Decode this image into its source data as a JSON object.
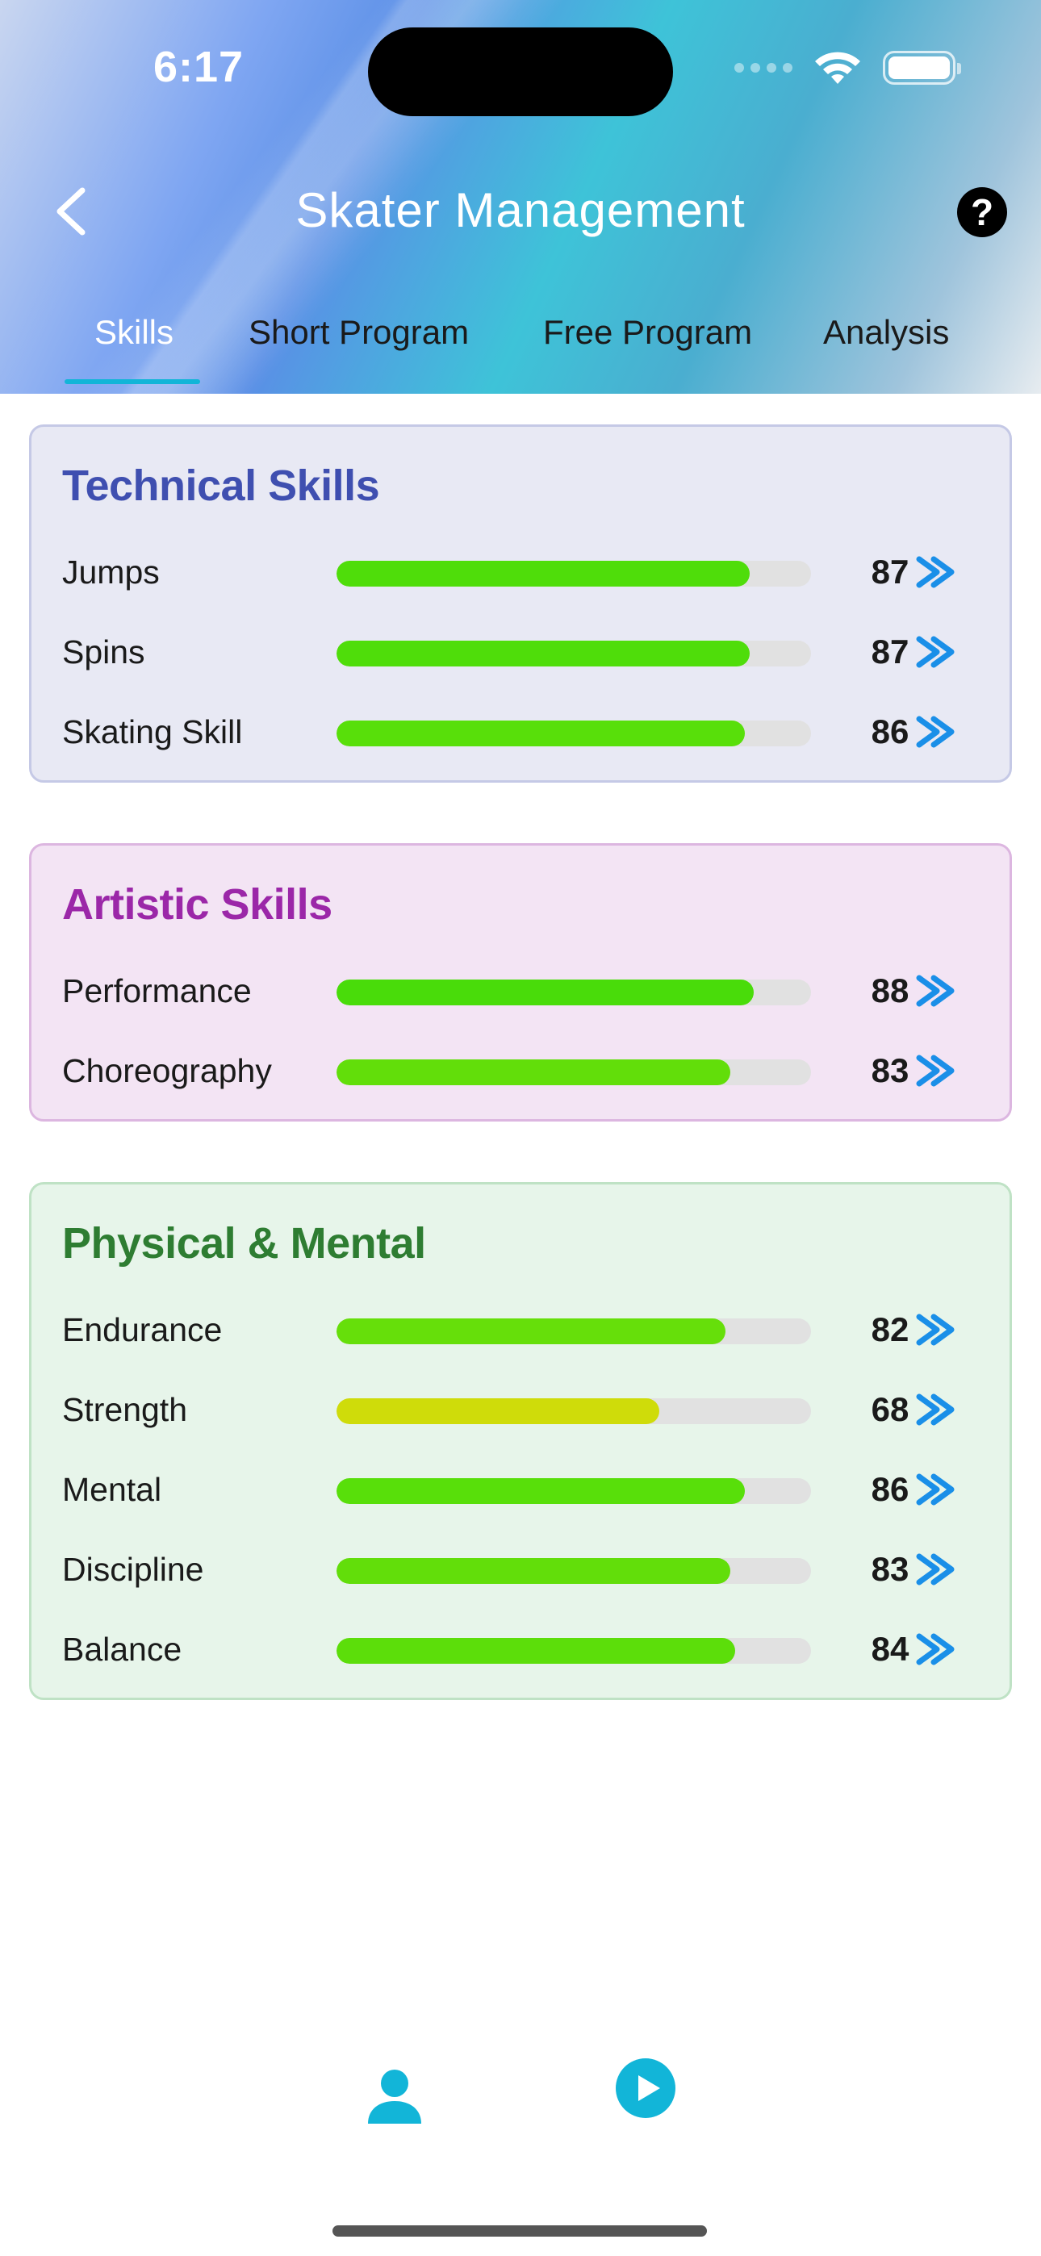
{
  "status_bar": {
    "time": "6:17"
  },
  "header": {
    "title": "Skater Management",
    "tabs": [
      "Skills",
      "Short Program",
      "Free Program",
      "Analysis"
    ],
    "active_tab": "Skills"
  },
  "sections": [
    {
      "title": "Technical Skills",
      "title_color": "#3f4fb0",
      "bg": "#e8e9f4",
      "border": "#c5c9e6",
      "items": [
        {
          "label": "Jumps",
          "value": "87",
          "level": 0.87,
          "color": "#4fdd0a"
        },
        {
          "label": "Spins",
          "value": "87",
          "level": 0.87,
          "color": "#4fdd0a"
        },
        {
          "label": "Skating Skill",
          "value": "86",
          "level": 0.86,
          "color": "#58df0a"
        }
      ]
    },
    {
      "title": "Artistic Skills",
      "title_color": "#9b27a8",
      "bg": "#f3e4f4",
      "border": "#dcb6e0",
      "items": [
        {
          "label": "Performance",
          "value": "88",
          "level": 0.88,
          "color": "#49dc0a"
        },
        {
          "label": "Choreography",
          "value": "83",
          "level": 0.83,
          "color": "#62de0a"
        }
      ]
    },
    {
      "title": "Physical & Mental",
      "title_color": "#2e7d32",
      "bg": "#e7f5ea",
      "border": "#bfe2c5",
      "items": [
        {
          "label": "Endurance",
          "value": "82",
          "level": 0.82,
          "color": "#66df0a"
        },
        {
          "label": "Strength",
          "value": "68",
          "level": 0.68,
          "color": "#cfdc0a"
        },
        {
          "label": "Mental",
          "value": "86",
          "level": 0.86,
          "color": "#58df0a"
        },
        {
          "label": "Discipline",
          "value": "83",
          "level": 0.83,
          "color": "#62de0a"
        },
        {
          "label": "Balance",
          "value": "84",
          "level": 0.84,
          "color": "#5cde0a"
        }
      ]
    }
  ],
  "accent": "#1a8fe8",
  "bottom_nav": {
    "icons": [
      "person-icon",
      "play-circle-icon"
    ],
    "icon_color": "#12b5d8"
  }
}
